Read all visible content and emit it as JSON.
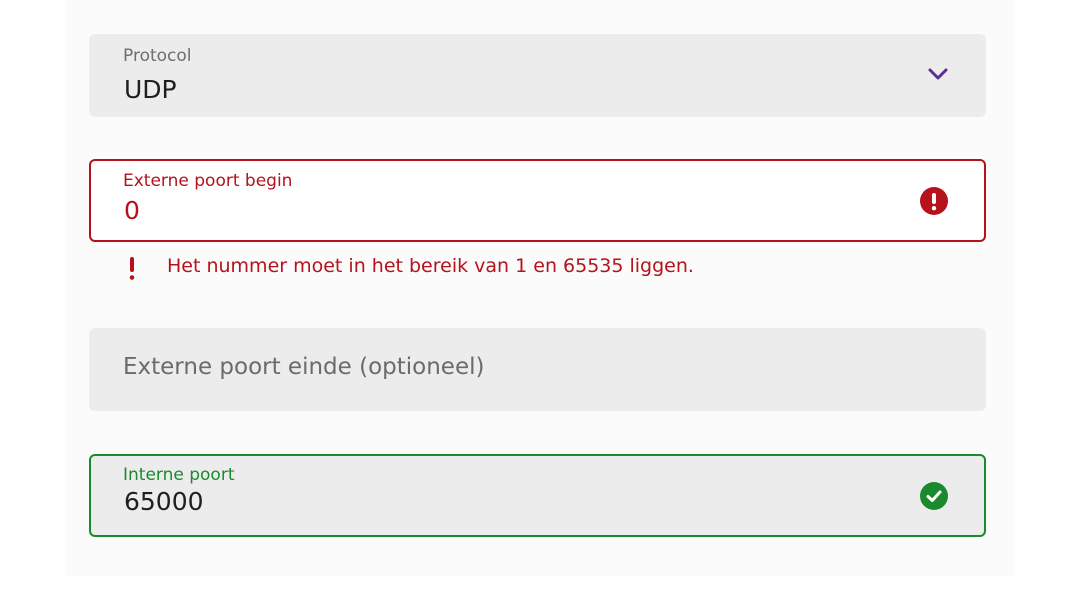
{
  "protocol": {
    "label": "Protocol",
    "value": "UDP",
    "icon": "chevron-down-icon"
  },
  "external_port_begin": {
    "label": "Externe poort begin",
    "value": "0",
    "status": "error",
    "icon": "error-circle-icon",
    "error_message": "Het nummer moet in het bereik van 1 en 65535 liggen."
  },
  "external_port_end": {
    "placeholder": "Externe poort einde (optioneel)"
  },
  "internal_port": {
    "label": "Interne poort",
    "value": "65000",
    "status": "valid",
    "icon": "check-circle-icon"
  },
  "colors": {
    "accent": "#5b2e91",
    "error": "#b5121b",
    "success": "#1b8a2e",
    "field_bg": "#ececec"
  }
}
